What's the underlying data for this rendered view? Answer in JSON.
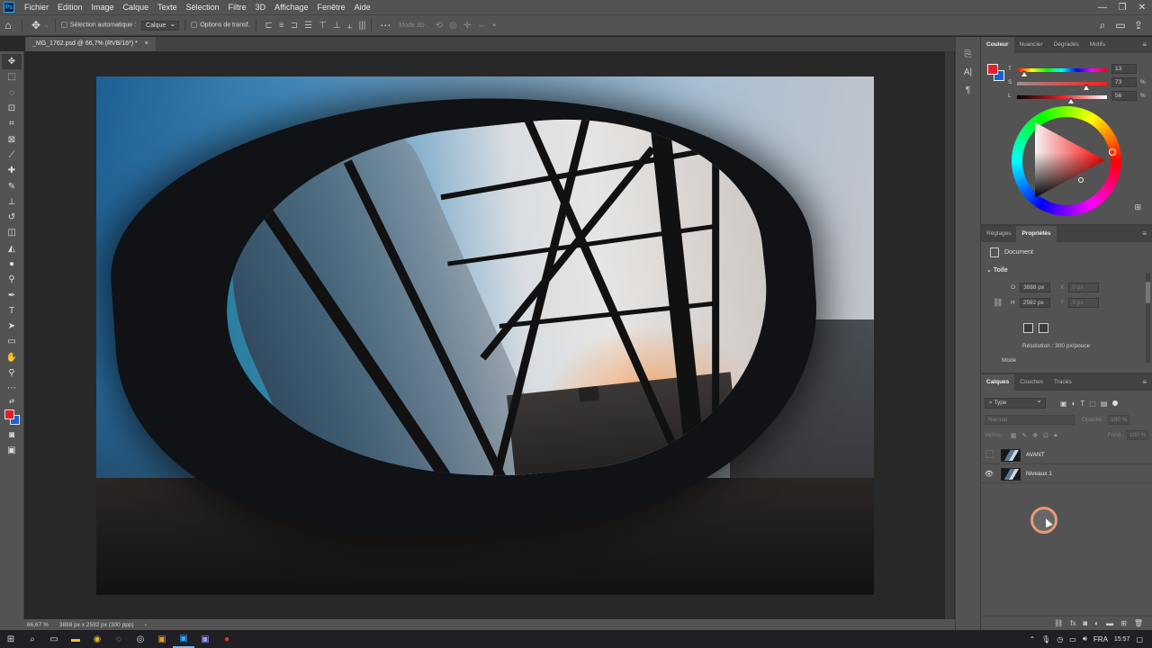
{
  "app": {
    "logo_text": "Ps"
  },
  "menubar": {
    "items": [
      "Fichier",
      "Edition",
      "Image",
      "Calque",
      "Texte",
      "Sélection",
      "Filtre",
      "3D",
      "Affichage",
      "Fenêtre",
      "Aide"
    ],
    "window_controls": [
      "—",
      "❐",
      "✕"
    ]
  },
  "optionsbar": {
    "auto_select_label": "Sélection automatique :",
    "auto_select_target": "Calque",
    "transform_label": "Options de transf.",
    "mode3d_label": "Mode 3D :"
  },
  "document": {
    "tab_title": "_MG_1762.psd @ 66,7% (RVB/16*) *",
    "tab_close": "×",
    "collapse_glyph": "«"
  },
  "statusbar": {
    "zoom": "66,67 %",
    "doc_info": "3888 px x 2592 px (300 ppp)",
    "arrow": "›"
  },
  "color_panel": {
    "tabs": [
      "Couleur",
      "Nuancier",
      "Dégradés",
      "Motifs"
    ],
    "active_tab": 0,
    "fg_color": "#e0212a",
    "bg_color": "#1a5fd6",
    "sliders": [
      {
        "label": "T",
        "value": "13",
        "unit": ""
      },
      {
        "label": "S",
        "value": "73",
        "unit": "%"
      },
      {
        "label": "L",
        "value": "56",
        "unit": "%"
      }
    ],
    "slider_levels": [
      0.04,
      0.73,
      0.56
    ]
  },
  "properties_panel": {
    "tabs": [
      "Réglages",
      "Propriétés"
    ],
    "active_tab": 1,
    "doc_label": "Document",
    "section": "Toile",
    "width_label": "O",
    "width_value": "3888 px",
    "height_label": "H",
    "height_value": "2592 px",
    "x_label": "X",
    "x_value": "0 px",
    "y_label": "Y",
    "y_value": "0 px",
    "resolution": "Résolution : 300 px/pouce",
    "mode_label": "Mode"
  },
  "layers_panel": {
    "tabs": [
      "Calques",
      "Couches",
      "Tracés"
    ],
    "active_tab": 0,
    "filter_type": "Type",
    "blend_mode": "Normal",
    "opacity_label": "Opacité :",
    "opacity_value": "100 %",
    "lock_label": "Verrou :",
    "fill_label": "Fond :",
    "fill_value": "100 %",
    "layers": [
      {
        "name": "AVANT",
        "visible": false
      },
      {
        "name": "Niveaux 1",
        "visible": true
      }
    ]
  },
  "taskbar": {
    "language": "FRA",
    "time": "15:57"
  }
}
